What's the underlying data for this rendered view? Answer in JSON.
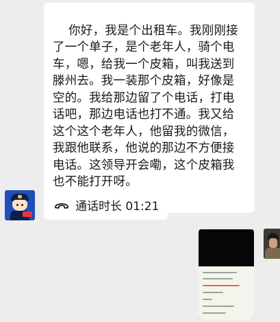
{
  "conversation": {
    "messages": [
      {
        "type": "text",
        "text": "你好，我是个出租车。我刚刚接了一个单子，是个老年人，骑个电车，嗯，给我一个皮箱，叫我送到滕州去。我一装那个皮箱，好像是空的。我给那边留了个电话，打电话吧，那边电话也打不通。我又给这个这个老年人，他留我的微信，我跟他联系，他说的那边不方便接电话。这领导开会嘞，这个皮箱我也不能打开呀。"
      },
      {
        "type": "call",
        "icon": "phone-handset-icon",
        "label": "通话时长 01:21"
      },
      {
        "type": "image",
        "description": "chat-screenshot-thumbnail"
      }
    ]
  },
  "colors": {
    "background": "#ededed",
    "bubble": "#ffffff",
    "text": "#1a1a1a"
  }
}
